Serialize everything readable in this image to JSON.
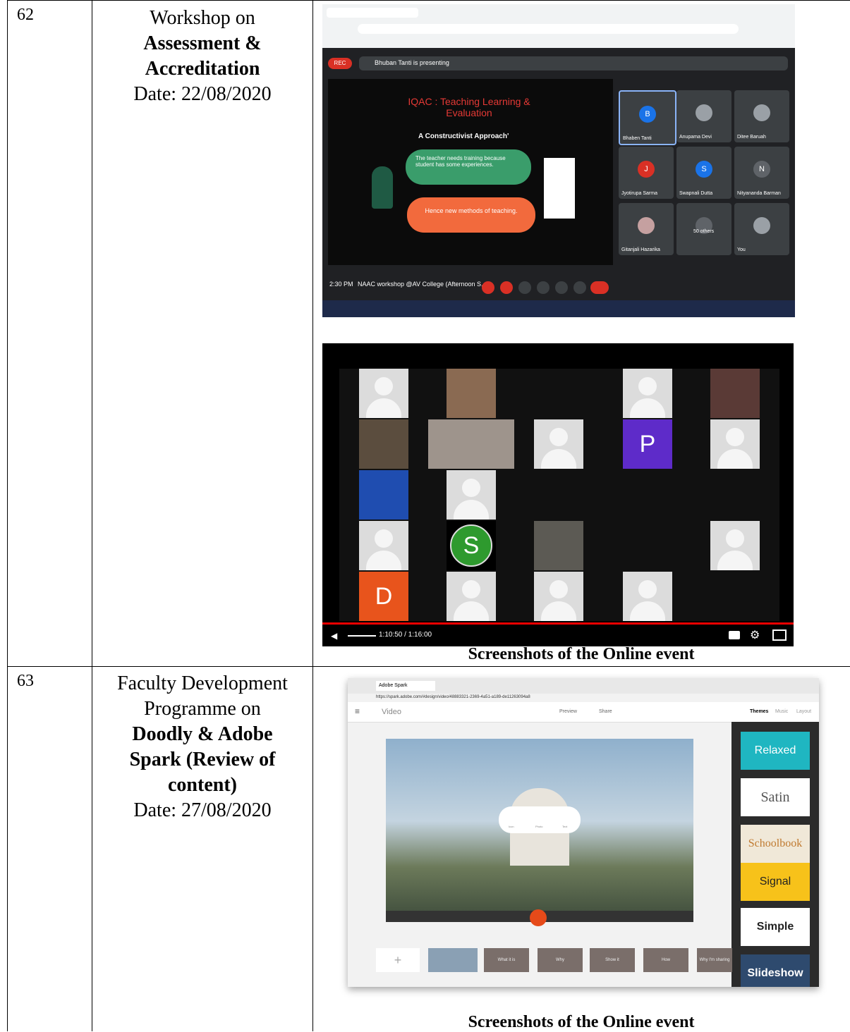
{
  "rows": [
    {
      "number": "62",
      "title_line1": "Workshop on",
      "title_bold1": "Assessment &",
      "title_bold2": "Accreditation",
      "date": "Date: 22/08/2020",
      "caption": "Screenshots of the Online event",
      "meet": {
        "presenting": "Bhuban Tanti is presenting",
        "rec": "REC",
        "slide_title": "IQAC : Teaching Learning & Evaluation",
        "slide_subtitle": "A Constructivist Approach'",
        "bubble1": "The teacher needs training because student has some experiences.",
        "bubble2": "Hence new methods of teaching.",
        "time": "2:30 PM",
        "meeting": "NAAC workshop @AV College (Afternoon S...",
        "participants": [
          {
            "name": "Bhaben Tanti",
            "initial": "B",
            "color": "#1a73e8"
          },
          {
            "name": "Anupama Devi",
            "initial": "",
            "color": "#9aa0a6"
          },
          {
            "name": "Ditee Baruah",
            "initial": "",
            "color": "#9aa0a6"
          },
          {
            "name": "Jyotirupa Sarma",
            "initial": "J",
            "color": "#d93025"
          },
          {
            "name": "Swapnali Dutta",
            "initial": "S",
            "color": "#1a73e8"
          },
          {
            "name": "Nityananda Barman",
            "initial": "N",
            "color": "#5f6368"
          },
          {
            "name": "Gitanjali Hazarika",
            "initial": "",
            "color": "#c5a0a0"
          },
          {
            "name": "50 others",
            "initial": "",
            "color": "#5f6368"
          },
          {
            "name": "You",
            "initial": "",
            "color": "#9aa0a6"
          }
        ]
      },
      "gallery": {
        "timecode": "1:10:50 / 1:16:00",
        "letter_p": "P",
        "letter_s": "S",
        "letter_d": "D"
      }
    },
    {
      "number": "63",
      "title_line1": "Faculty Development",
      "title_line2": "Programme on",
      "title_bold1": "Doodly &  Adobe",
      "title_bold2": "Spark (Review of",
      "title_bold3": "content)",
      "date": "Date: 27/08/2020",
      "caption": "Screenshots of the Online event",
      "spark": {
        "tab": "Adobe Spark",
        "url": "https://spark.adobe.com/#design/video/48883321-2369-4a51-a189-de11263094a8",
        "app": "Video",
        "preview": "Preview",
        "share": "Share",
        "tabs": [
          "Themes",
          "Music",
          "Layout"
        ],
        "themes": [
          "Relaxed",
          "Satin",
          "Schoolbook",
          "Signal",
          "Simple",
          "Slideshow"
        ],
        "tools": [
          "Icon",
          "Photo",
          "Text"
        ],
        "strip": [
          "What it is",
          "Why",
          "Show it",
          "How",
          "Why I'm sharing"
        ]
      }
    }
  ]
}
